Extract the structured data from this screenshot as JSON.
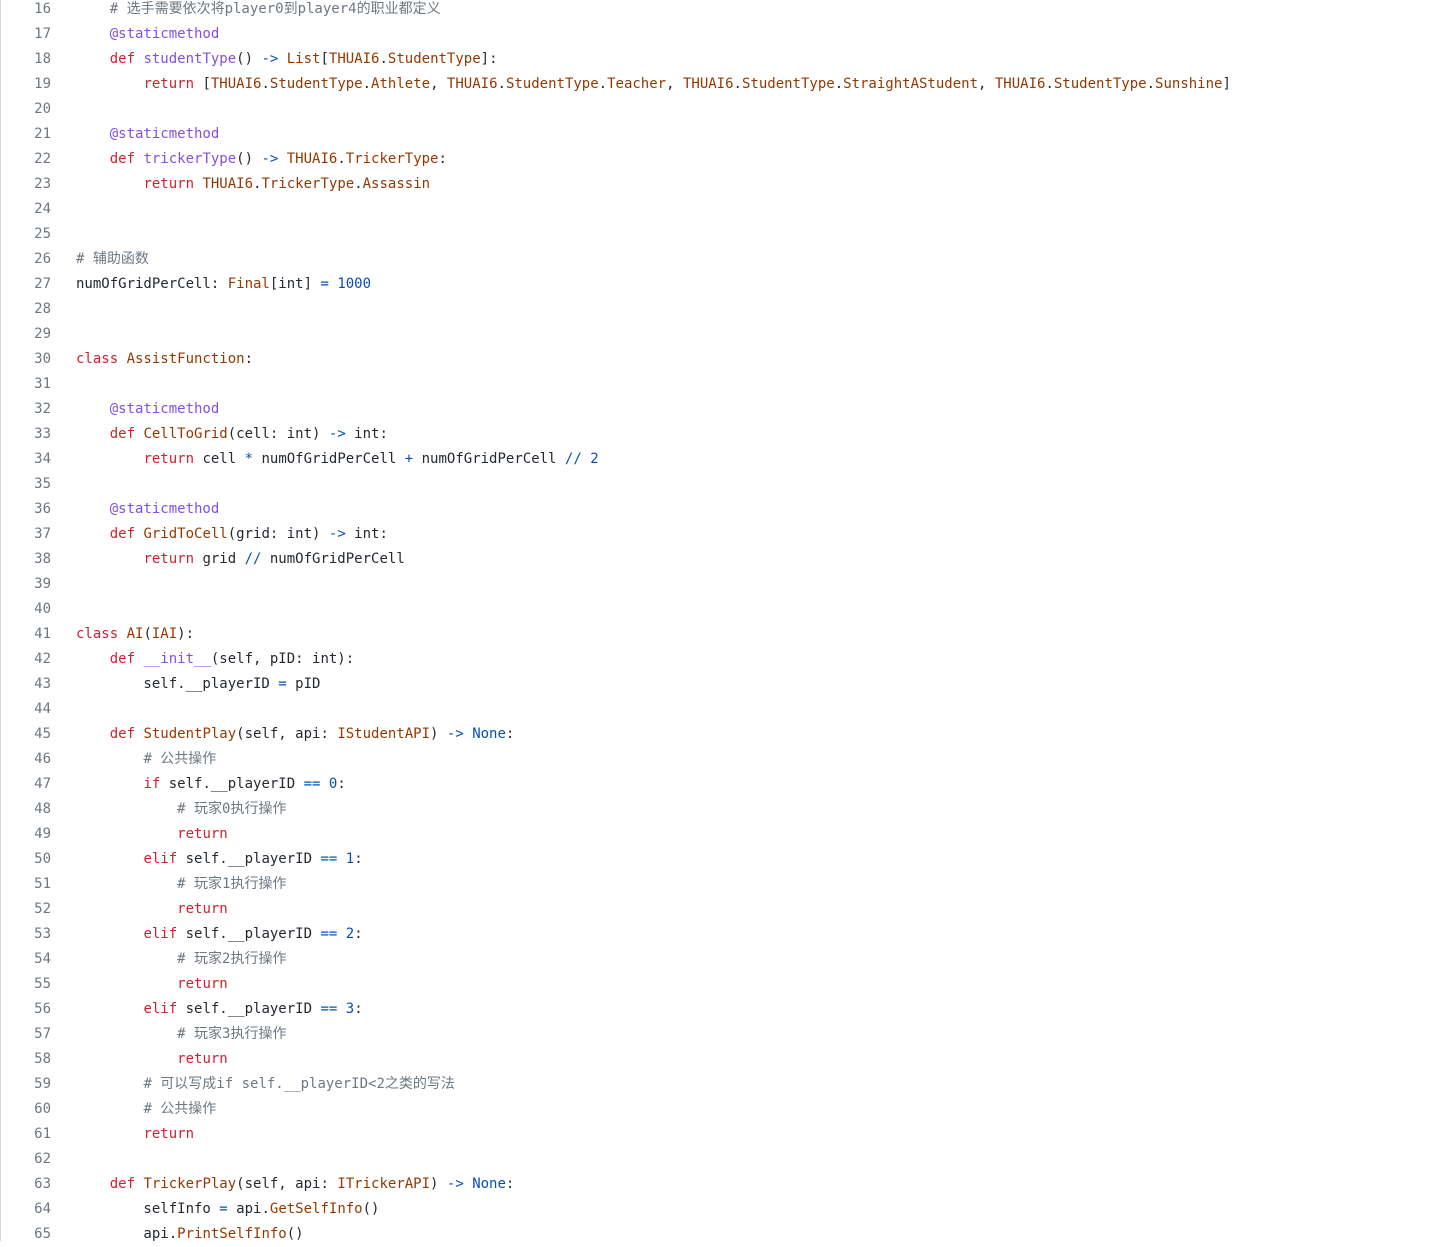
{
  "editor": {
    "language": "python",
    "colors": {
      "background": "#ffffff",
      "line_number": "#6e7781",
      "keyword": "#cf222e",
      "function": "#8250df",
      "decorator": "#8250df",
      "type": "#953800",
      "number": "#0550ae",
      "operator": "#0550ae",
      "comment": "#6e7781",
      "text": "#24292f"
    },
    "lines": [
      {
        "num": "16",
        "tokens": [
          {
            "t": "    ",
            "c": "tx"
          },
          {
            "t": "# 选手需要依次将player0到player4的职业都定义",
            "c": "cm"
          }
        ]
      },
      {
        "num": "17",
        "tokens": [
          {
            "t": "    ",
            "c": "tx"
          },
          {
            "t": "@staticmethod",
            "c": "dec"
          }
        ]
      },
      {
        "num": "18",
        "tokens": [
          {
            "t": "    ",
            "c": "tx"
          },
          {
            "t": "def ",
            "c": "kw"
          },
          {
            "t": "studentType",
            "c": "fn"
          },
          {
            "t": "() ",
            "c": "tx"
          },
          {
            "t": "->",
            "c": "op"
          },
          {
            "t": " ",
            "c": "tx"
          },
          {
            "t": "List",
            "c": "ty"
          },
          {
            "t": "[",
            "c": "tx"
          },
          {
            "t": "THUAI6",
            "c": "ty"
          },
          {
            "t": ".",
            "c": "tx"
          },
          {
            "t": "StudentType",
            "c": "ty"
          },
          {
            "t": "]:",
            "c": "tx"
          }
        ]
      },
      {
        "num": "19",
        "tokens": [
          {
            "t": "        ",
            "c": "tx"
          },
          {
            "t": "return",
            "c": "kw"
          },
          {
            "t": " [",
            "c": "tx"
          },
          {
            "t": "THUAI6",
            "c": "ty"
          },
          {
            "t": ".",
            "c": "tx"
          },
          {
            "t": "StudentType",
            "c": "ty"
          },
          {
            "t": ".",
            "c": "tx"
          },
          {
            "t": "Athlete",
            "c": "ty"
          },
          {
            "t": ", ",
            "c": "tx"
          },
          {
            "t": "THUAI6",
            "c": "ty"
          },
          {
            "t": ".",
            "c": "tx"
          },
          {
            "t": "StudentType",
            "c": "ty"
          },
          {
            "t": ".",
            "c": "tx"
          },
          {
            "t": "Teacher",
            "c": "ty"
          },
          {
            "t": ", ",
            "c": "tx"
          },
          {
            "t": "THUAI6",
            "c": "ty"
          },
          {
            "t": ".",
            "c": "tx"
          },
          {
            "t": "StudentType",
            "c": "ty"
          },
          {
            "t": ".",
            "c": "tx"
          },
          {
            "t": "StraightAStudent",
            "c": "ty"
          },
          {
            "t": ", ",
            "c": "tx"
          },
          {
            "t": "THUAI6",
            "c": "ty"
          },
          {
            "t": ".",
            "c": "tx"
          },
          {
            "t": "StudentType",
            "c": "ty"
          },
          {
            "t": ".",
            "c": "tx"
          },
          {
            "t": "Sunshine",
            "c": "ty"
          },
          {
            "t": "]",
            "c": "tx"
          }
        ]
      },
      {
        "num": "20",
        "tokens": []
      },
      {
        "num": "21",
        "tokens": [
          {
            "t": "    ",
            "c": "tx"
          },
          {
            "t": "@staticmethod",
            "c": "dec"
          }
        ]
      },
      {
        "num": "22",
        "tokens": [
          {
            "t": "    ",
            "c": "tx"
          },
          {
            "t": "def ",
            "c": "kw"
          },
          {
            "t": "trickerType",
            "c": "fn"
          },
          {
            "t": "() ",
            "c": "tx"
          },
          {
            "t": "->",
            "c": "op"
          },
          {
            "t": " ",
            "c": "tx"
          },
          {
            "t": "THUAI6",
            "c": "ty"
          },
          {
            "t": ".",
            "c": "tx"
          },
          {
            "t": "TrickerType",
            "c": "ty"
          },
          {
            "t": ":",
            "c": "tx"
          }
        ]
      },
      {
        "num": "23",
        "tokens": [
          {
            "t": "        ",
            "c": "tx"
          },
          {
            "t": "return",
            "c": "kw"
          },
          {
            "t": " ",
            "c": "tx"
          },
          {
            "t": "THUAI6",
            "c": "ty"
          },
          {
            "t": ".",
            "c": "tx"
          },
          {
            "t": "TrickerType",
            "c": "ty"
          },
          {
            "t": ".",
            "c": "tx"
          },
          {
            "t": "Assassin",
            "c": "ty"
          }
        ]
      },
      {
        "num": "24",
        "tokens": []
      },
      {
        "num": "25",
        "tokens": []
      },
      {
        "num": "26",
        "tokens": [
          {
            "t": "# 辅助函数",
            "c": "cm"
          }
        ]
      },
      {
        "num": "27",
        "tokens": [
          {
            "t": "numOfGridPerCell: ",
            "c": "tx"
          },
          {
            "t": "Final",
            "c": "ty"
          },
          {
            "t": "[int] ",
            "c": "tx"
          },
          {
            "t": "=",
            "c": "op"
          },
          {
            "t": " ",
            "c": "tx"
          },
          {
            "t": "1000",
            "c": "nm"
          }
        ]
      },
      {
        "num": "28",
        "tokens": []
      },
      {
        "num": "29",
        "tokens": []
      },
      {
        "num": "30",
        "tokens": [
          {
            "t": "class ",
            "c": "kw"
          },
          {
            "t": "AssistFunction",
            "c": "ty"
          },
          {
            "t": ":",
            "c": "tx"
          }
        ]
      },
      {
        "num": "31",
        "tokens": []
      },
      {
        "num": "32",
        "tokens": [
          {
            "t": "    ",
            "c": "tx"
          },
          {
            "t": "@staticmethod",
            "c": "dec"
          }
        ]
      },
      {
        "num": "33",
        "tokens": [
          {
            "t": "    ",
            "c": "tx"
          },
          {
            "t": "def ",
            "c": "kw"
          },
          {
            "t": "CellToGrid",
            "c": "ty"
          },
          {
            "t": "(cell: int) ",
            "c": "tx"
          },
          {
            "t": "->",
            "c": "op"
          },
          {
            "t": " int:",
            "c": "tx"
          }
        ]
      },
      {
        "num": "34",
        "tokens": [
          {
            "t": "        ",
            "c": "tx"
          },
          {
            "t": "return",
            "c": "kw"
          },
          {
            "t": " cell ",
            "c": "tx"
          },
          {
            "t": "*",
            "c": "op"
          },
          {
            "t": " numOfGridPerCell ",
            "c": "tx"
          },
          {
            "t": "+",
            "c": "op"
          },
          {
            "t": " numOfGridPerCell ",
            "c": "tx"
          },
          {
            "t": "//",
            "c": "op"
          },
          {
            "t": " ",
            "c": "tx"
          },
          {
            "t": "2",
            "c": "nm"
          }
        ]
      },
      {
        "num": "35",
        "tokens": []
      },
      {
        "num": "36",
        "tokens": [
          {
            "t": "    ",
            "c": "tx"
          },
          {
            "t": "@staticmethod",
            "c": "dec"
          }
        ]
      },
      {
        "num": "37",
        "tokens": [
          {
            "t": "    ",
            "c": "tx"
          },
          {
            "t": "def ",
            "c": "kw"
          },
          {
            "t": "GridToCell",
            "c": "ty"
          },
          {
            "t": "(grid: int) ",
            "c": "tx"
          },
          {
            "t": "->",
            "c": "op"
          },
          {
            "t": " int:",
            "c": "tx"
          }
        ]
      },
      {
        "num": "38",
        "tokens": [
          {
            "t": "        ",
            "c": "tx"
          },
          {
            "t": "return",
            "c": "kw"
          },
          {
            "t": " grid ",
            "c": "tx"
          },
          {
            "t": "//",
            "c": "op"
          },
          {
            "t": " numOfGridPerCell",
            "c": "tx"
          }
        ]
      },
      {
        "num": "39",
        "tokens": []
      },
      {
        "num": "40",
        "tokens": []
      },
      {
        "num": "41",
        "tokens": [
          {
            "t": "class ",
            "c": "kw"
          },
          {
            "t": "AI",
            "c": "ty"
          },
          {
            "t": "(",
            "c": "tx"
          },
          {
            "t": "IAI",
            "c": "ty"
          },
          {
            "t": "):",
            "c": "tx"
          }
        ]
      },
      {
        "num": "42",
        "tokens": [
          {
            "t": "    ",
            "c": "tx"
          },
          {
            "t": "def ",
            "c": "kw"
          },
          {
            "t": "__init__",
            "c": "fn"
          },
          {
            "t": "(self, pID: int):",
            "c": "tx"
          }
        ]
      },
      {
        "num": "43",
        "tokens": [
          {
            "t": "        self.__playerID ",
            "c": "tx"
          },
          {
            "t": "=",
            "c": "op"
          },
          {
            "t": " pID",
            "c": "tx"
          }
        ]
      },
      {
        "num": "44",
        "tokens": []
      },
      {
        "num": "45",
        "tokens": [
          {
            "t": "    ",
            "c": "tx"
          },
          {
            "t": "def ",
            "c": "kw"
          },
          {
            "t": "StudentPlay",
            "c": "ty"
          },
          {
            "t": "(self, api: ",
            "c": "tx"
          },
          {
            "t": "IStudentAPI",
            "c": "ty"
          },
          {
            "t": ") ",
            "c": "tx"
          },
          {
            "t": "->",
            "c": "op"
          },
          {
            "t": " ",
            "c": "tx"
          },
          {
            "t": "None",
            "c": "bi"
          },
          {
            "t": ":",
            "c": "tx"
          }
        ]
      },
      {
        "num": "46",
        "tokens": [
          {
            "t": "        ",
            "c": "tx"
          },
          {
            "t": "# 公共操作",
            "c": "cm"
          }
        ]
      },
      {
        "num": "47",
        "tokens": [
          {
            "t": "        ",
            "c": "tx"
          },
          {
            "t": "if",
            "c": "kw"
          },
          {
            "t": " self.__playerID ",
            "c": "tx"
          },
          {
            "t": "==",
            "c": "op"
          },
          {
            "t": " ",
            "c": "tx"
          },
          {
            "t": "0",
            "c": "nm"
          },
          {
            "t": ":",
            "c": "tx"
          }
        ]
      },
      {
        "num": "48",
        "tokens": [
          {
            "t": "            ",
            "c": "tx"
          },
          {
            "t": "# 玩家0执行操作",
            "c": "cm"
          }
        ]
      },
      {
        "num": "49",
        "tokens": [
          {
            "t": "            ",
            "c": "tx"
          },
          {
            "t": "return",
            "c": "kw"
          }
        ]
      },
      {
        "num": "50",
        "tokens": [
          {
            "t": "        ",
            "c": "tx"
          },
          {
            "t": "elif",
            "c": "kw"
          },
          {
            "t": " self.__playerID ",
            "c": "tx"
          },
          {
            "t": "==",
            "c": "op"
          },
          {
            "t": " ",
            "c": "tx"
          },
          {
            "t": "1",
            "c": "nm"
          },
          {
            "t": ":",
            "c": "tx"
          }
        ]
      },
      {
        "num": "51",
        "tokens": [
          {
            "t": "            ",
            "c": "tx"
          },
          {
            "t": "# 玩家1执行操作",
            "c": "cm"
          }
        ]
      },
      {
        "num": "52",
        "tokens": [
          {
            "t": "            ",
            "c": "tx"
          },
          {
            "t": "return",
            "c": "kw"
          }
        ]
      },
      {
        "num": "53",
        "tokens": [
          {
            "t": "        ",
            "c": "tx"
          },
          {
            "t": "elif",
            "c": "kw"
          },
          {
            "t": " self.__playerID ",
            "c": "tx"
          },
          {
            "t": "==",
            "c": "op"
          },
          {
            "t": " ",
            "c": "tx"
          },
          {
            "t": "2",
            "c": "nm"
          },
          {
            "t": ":",
            "c": "tx"
          }
        ]
      },
      {
        "num": "54",
        "tokens": [
          {
            "t": "            ",
            "c": "tx"
          },
          {
            "t": "# 玩家2执行操作",
            "c": "cm"
          }
        ]
      },
      {
        "num": "55",
        "tokens": [
          {
            "t": "            ",
            "c": "tx"
          },
          {
            "t": "return",
            "c": "kw"
          }
        ]
      },
      {
        "num": "56",
        "tokens": [
          {
            "t": "        ",
            "c": "tx"
          },
          {
            "t": "elif",
            "c": "kw"
          },
          {
            "t": " self.__playerID ",
            "c": "tx"
          },
          {
            "t": "==",
            "c": "op"
          },
          {
            "t": " ",
            "c": "tx"
          },
          {
            "t": "3",
            "c": "nm"
          },
          {
            "t": ":",
            "c": "tx"
          }
        ]
      },
      {
        "num": "57",
        "tokens": [
          {
            "t": "            ",
            "c": "tx"
          },
          {
            "t": "# 玩家3执行操作",
            "c": "cm"
          }
        ]
      },
      {
        "num": "58",
        "tokens": [
          {
            "t": "            ",
            "c": "tx"
          },
          {
            "t": "return",
            "c": "kw"
          }
        ]
      },
      {
        "num": "59",
        "tokens": [
          {
            "t": "        ",
            "c": "tx"
          },
          {
            "t": "# 可以写成if self.__playerID<2之类的写法",
            "c": "cm"
          }
        ]
      },
      {
        "num": "60",
        "tokens": [
          {
            "t": "        ",
            "c": "tx"
          },
          {
            "t": "# 公共操作",
            "c": "cm"
          }
        ]
      },
      {
        "num": "61",
        "tokens": [
          {
            "t": "        ",
            "c": "tx"
          },
          {
            "t": "return",
            "c": "kw"
          }
        ]
      },
      {
        "num": "62",
        "tokens": []
      },
      {
        "num": "63",
        "tokens": [
          {
            "t": "    ",
            "c": "tx"
          },
          {
            "t": "def ",
            "c": "kw"
          },
          {
            "t": "TrickerPlay",
            "c": "ty"
          },
          {
            "t": "(self, api: ",
            "c": "tx"
          },
          {
            "t": "ITrickerAPI",
            "c": "ty"
          },
          {
            "t": ") ",
            "c": "tx"
          },
          {
            "t": "->",
            "c": "op"
          },
          {
            "t": " ",
            "c": "tx"
          },
          {
            "t": "None",
            "c": "bi"
          },
          {
            "t": ":",
            "c": "tx"
          }
        ]
      },
      {
        "num": "64",
        "tokens": [
          {
            "t": "        selfInfo ",
            "c": "tx"
          },
          {
            "t": "=",
            "c": "op"
          },
          {
            "t": " api.",
            "c": "tx"
          },
          {
            "t": "GetSelfInfo",
            "c": "ty"
          },
          {
            "t": "()",
            "c": "tx"
          }
        ]
      },
      {
        "num": "65",
        "tokens": [
          {
            "t": "        api.",
            "c": "tx"
          },
          {
            "t": "PrintSelfInfo",
            "c": "ty"
          },
          {
            "t": "()",
            "c": "tx"
          }
        ]
      }
    ]
  }
}
